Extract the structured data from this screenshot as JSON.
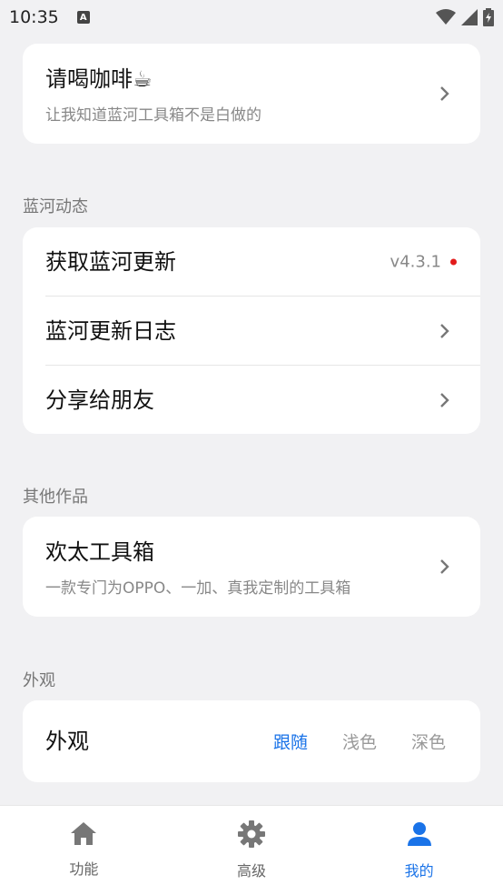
{
  "status_bar": {
    "time": "10:35",
    "notification_badge": "A"
  },
  "coffee_card": {
    "title": "请喝咖啡☕",
    "subtitle": "让我知道蓝河工具箱不是白做的"
  },
  "lanhe_section": {
    "label": "蓝河动态",
    "items": [
      {
        "title": "获取蓝河更新",
        "version": "v4.3.1"
      },
      {
        "title": "蓝河更新日志"
      },
      {
        "title": "分享给朋友"
      }
    ]
  },
  "other_works_section": {
    "label": "其他作品",
    "item": {
      "title": "欢太工具箱",
      "subtitle": "一款专门为OPPO、一加、真我定制的工具箱"
    }
  },
  "appearance_section": {
    "label": "外观",
    "row_title": "外观",
    "options": [
      "跟随",
      "浅色",
      "深色"
    ],
    "selected": "跟随"
  },
  "bottom_nav": {
    "items": [
      {
        "label": "功能",
        "icon": "home-icon"
      },
      {
        "label": "高级",
        "icon": "gear-icon"
      },
      {
        "label": "我的",
        "icon": "person-icon"
      }
    ],
    "active": "我的"
  },
  "colors": {
    "accent": "#1a73e8",
    "dot": "#e21b1b",
    "background": "#f1f1f3"
  }
}
